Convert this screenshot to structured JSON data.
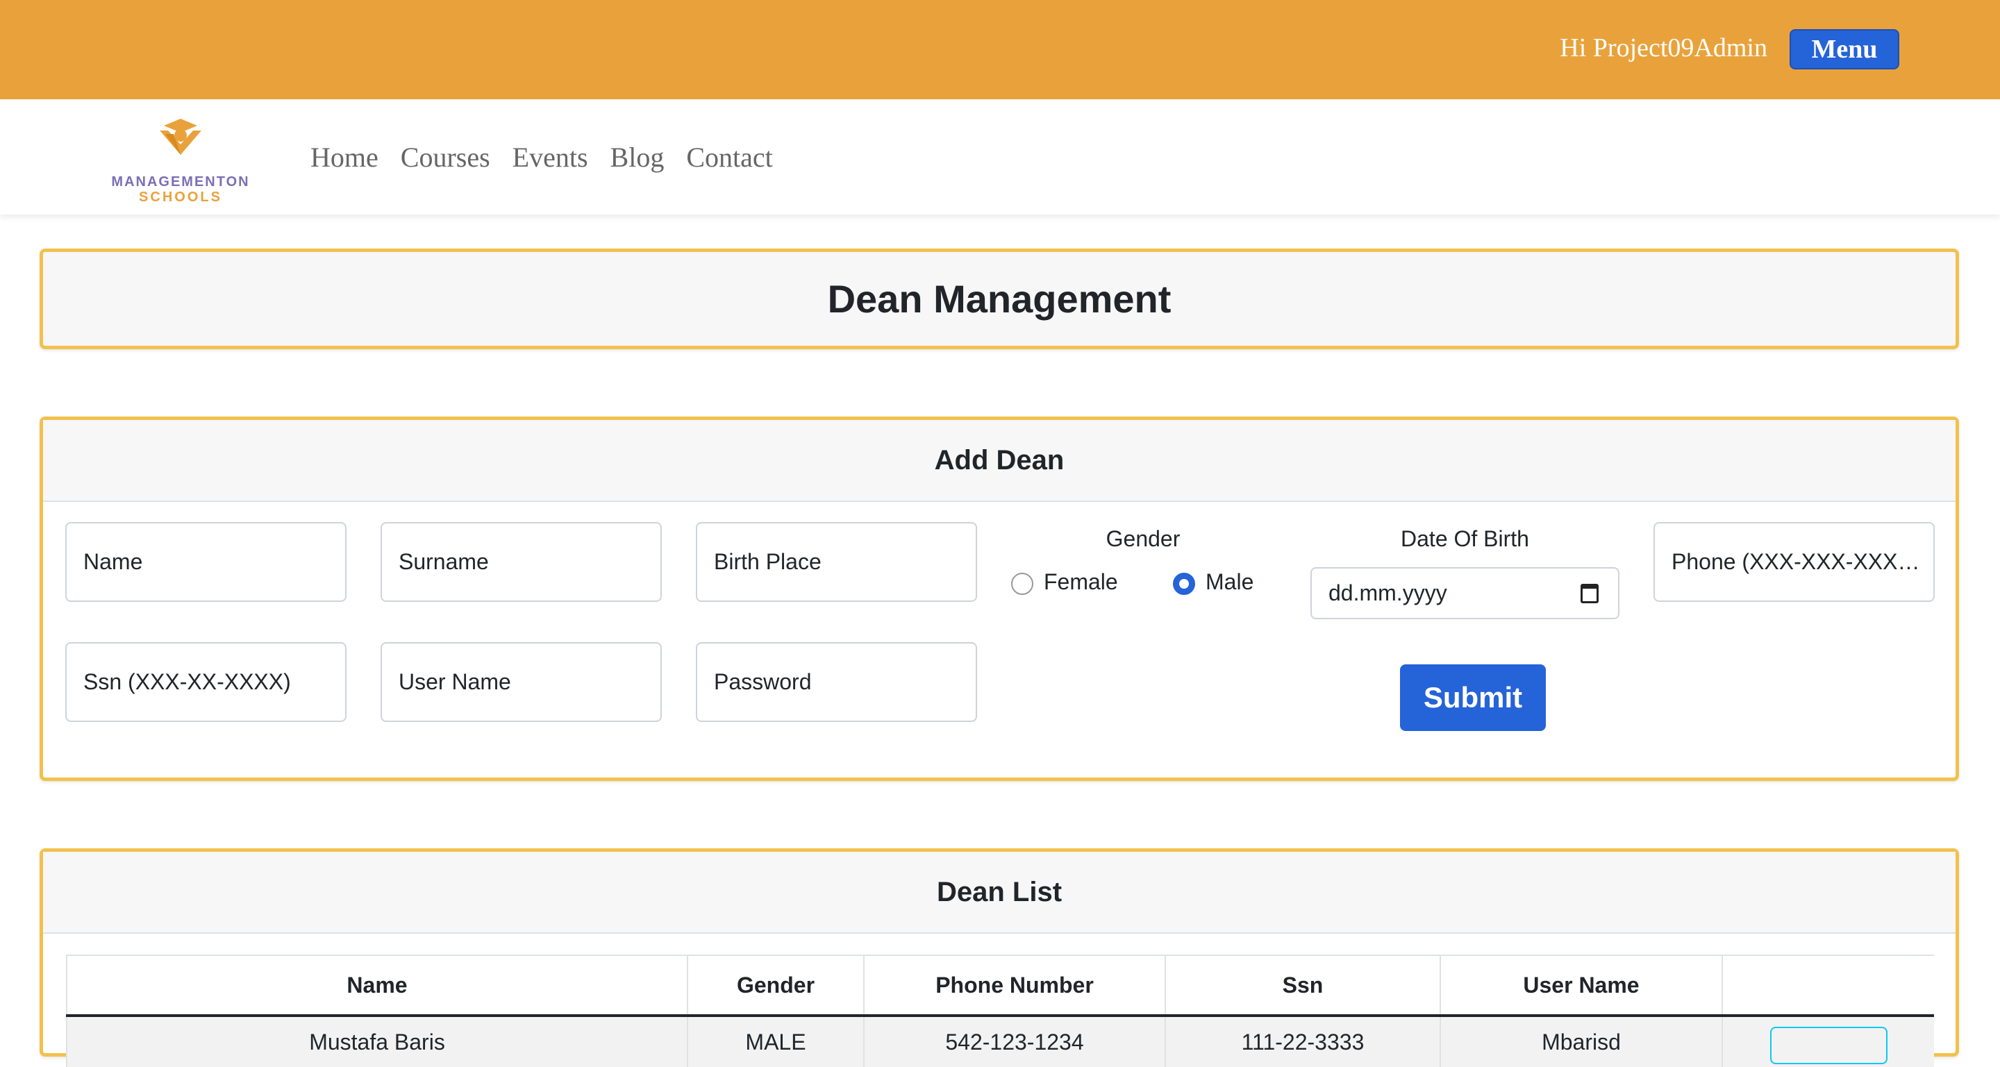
{
  "header": {
    "greeting": "Hi Project09Admin",
    "menu_label": "Menu"
  },
  "brand": {
    "line1": "MANAGEMENTON",
    "line2": "SCHOOLS"
  },
  "nav": {
    "items": [
      {
        "label": "Home"
      },
      {
        "label": "Courses"
      },
      {
        "label": "Events"
      },
      {
        "label": "Blog"
      },
      {
        "label": "Contact"
      }
    ]
  },
  "page": {
    "title": "Dean Management"
  },
  "add_dean": {
    "title": "Add Dean",
    "fields": {
      "name": "Name",
      "surname": "Surname",
      "birth_place": "Birth Place",
      "phone": "Phone (XXX-XXX-XXX…",
      "ssn": "Ssn (XXX-XX-XXXX)",
      "username": "User Name",
      "password": "Password"
    },
    "gender": {
      "label": "Gender",
      "options": [
        "Female",
        "Male"
      ],
      "selected": "Male"
    },
    "dob": {
      "label": "Date Of Birth",
      "placeholder": "dd.mm.yyyy"
    },
    "submit_label": "Submit"
  },
  "dean_list": {
    "title": "Dean List",
    "columns": [
      "Name",
      "Gender",
      "Phone Number",
      "Ssn",
      "User Name",
      ""
    ],
    "rows": [
      {
        "name": "Mustafa Baris",
        "gender": "MALE",
        "phone": "542-123-1234",
        "ssn": "111-22-3333",
        "username": "Mbarisd"
      }
    ]
  },
  "colors": {
    "topbar": "#E9A23B",
    "accent_blue": "#2563D8",
    "card_border": "#F2C14E"
  }
}
